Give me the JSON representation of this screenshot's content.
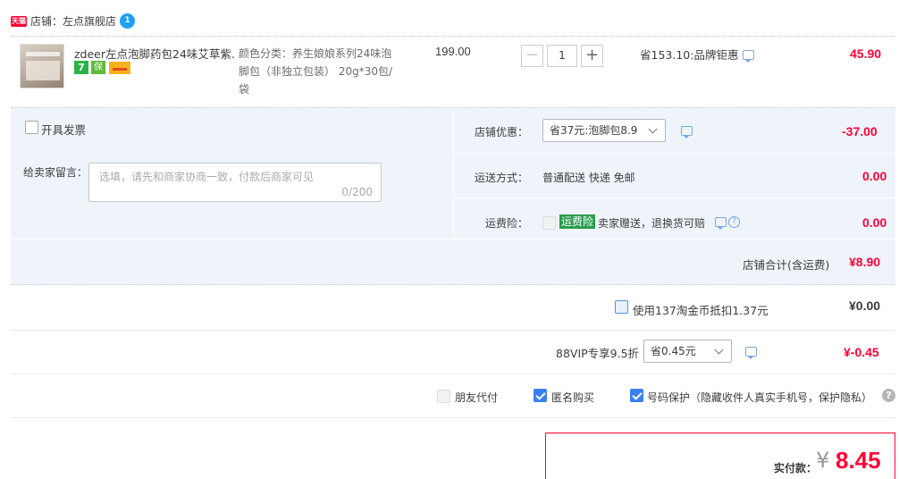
{
  "shop": {
    "badge": "天猫",
    "label": "店铺：",
    "name": "左点旗舰店"
  },
  "item": {
    "title": "zdeer左点泡脚药包24味艾草紫...",
    "spec_label": "颜色分类：",
    "spec_lines": [
      "养生娘娘系列24味泡",
      "脚包（非独立包装） 20g*30包/",
      "袋"
    ],
    "unit_price": "199.00",
    "quantity": "1",
    "discount": "省153.10:品牌钜惠",
    "subtotal": "45.90",
    "badges": [
      "7",
      "保",
      "卡"
    ]
  },
  "invoice": {
    "label": "开具发票"
  },
  "message": {
    "label": "给卖家留言：",
    "placeholder": "选填，请先和商家协商一致，付款后商家可见",
    "counter": "0/200"
  },
  "shop_discount": {
    "label": "店铺优惠：",
    "selected": "省37元:泡脚包8.9",
    "amount": "-37.00"
  },
  "shipping": {
    "label": "运送方式：",
    "value": "普通配送 快递 免邮",
    "amount": "0.00"
  },
  "insurance": {
    "label": "运费险：",
    "tag": "运费险",
    "value": "卖家赠送，退换货可赔",
    "amount": "0.00"
  },
  "shop_total": {
    "label": "店铺合计(含运费)",
    "value": "¥8.90"
  },
  "coins": {
    "label": "使用137淘金币抵扣1.37元",
    "value": "¥0.00"
  },
  "vip": {
    "label": "88VIP专享9.5折",
    "selected": "省0.45元",
    "value": "¥-0.45"
  },
  "options": {
    "friend_pay": "朋友代付",
    "anonymous": "匿名购买",
    "number_protect": "号码保护（隐藏收件人真实手机号，保护隐私）"
  },
  "pay": {
    "label": "实付款：",
    "currency": "¥",
    "value": "8.45"
  },
  "icons": {
    "help": "?"
  },
  "colors": {
    "accent_red": "#ff0036",
    "panel_bg": "#eff4fb",
    "checkbox_blue": "#3a7ff0",
    "insurance_green": "#2a9c4f"
  }
}
